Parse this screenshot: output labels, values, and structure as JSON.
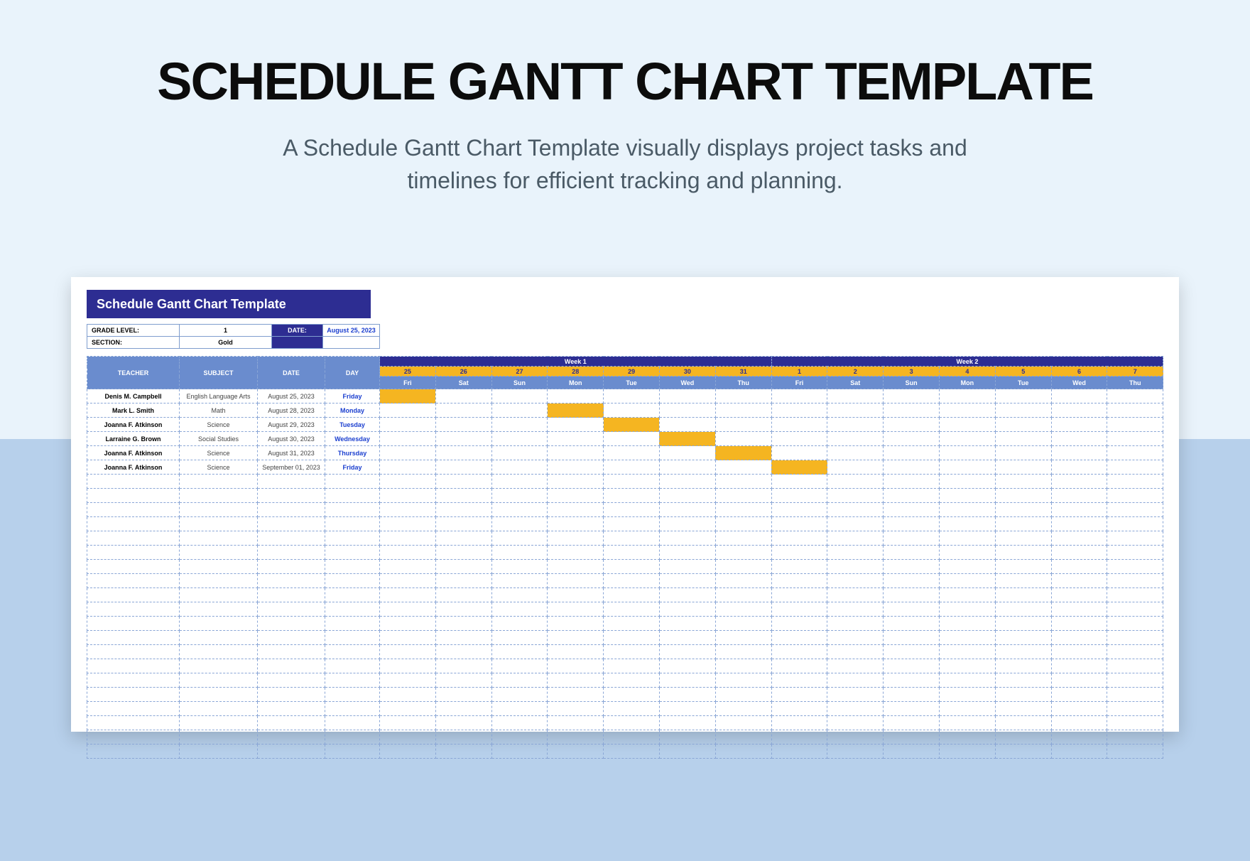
{
  "page": {
    "title": "SCHEDULE GANTT CHART TEMPLATE",
    "subtitle_l1": "A Schedule Gantt Chart Template visually displays project tasks and",
    "subtitle_l2": "timelines for efficient tracking and planning."
  },
  "sheet": {
    "title": "Schedule Gantt Chart Template",
    "meta": {
      "grade_label": "GRADE LEVEL:",
      "grade_value": "1",
      "date_label": "DATE:",
      "date_value": "August 25, 2023",
      "section_label": "SECTION:",
      "section_value": "Gold"
    },
    "headers": {
      "teacher": "TEACHER",
      "subject": "SUBJECT",
      "date": "DATE",
      "day": "DAY",
      "week1": "Week 1",
      "week2": "Week 2"
    },
    "days": [
      {
        "num": "25",
        "name": "Fri"
      },
      {
        "num": "26",
        "name": "Sat"
      },
      {
        "num": "27",
        "name": "Sun"
      },
      {
        "num": "28",
        "name": "Mon"
      },
      {
        "num": "29",
        "name": "Tue"
      },
      {
        "num": "30",
        "name": "Wed"
      },
      {
        "num": "31",
        "name": "Thu"
      },
      {
        "num": "1",
        "name": "Fri"
      },
      {
        "num": "2",
        "name": "Sat"
      },
      {
        "num": "3",
        "name": "Sun"
      },
      {
        "num": "4",
        "name": "Mon"
      },
      {
        "num": "5",
        "name": "Tue"
      },
      {
        "num": "6",
        "name": "Wed"
      },
      {
        "num": "7",
        "name": "Thu"
      }
    ],
    "rows": [
      {
        "teacher": "Denis M. Campbell",
        "subject": "English Language Arts",
        "date": "August 25, 2023",
        "day": "Friday",
        "bar": 0
      },
      {
        "teacher": "Mark L. Smith",
        "subject": "Math",
        "date": "August 28, 2023",
        "day": "Monday",
        "bar": 3
      },
      {
        "teacher": "Joanna F. Atkinson",
        "subject": "Science",
        "date": "August 29, 2023",
        "day": "Tuesday",
        "bar": 4
      },
      {
        "teacher": "Larraine G. Brown",
        "subject": "Social Studies",
        "date": "August 30, 2023",
        "day": "Wednesday",
        "bar": 5
      },
      {
        "teacher": "Joanna F. Atkinson",
        "subject": "Science",
        "date": "August 31, 2023",
        "day": "Thursday",
        "bar": 6
      },
      {
        "teacher": "Joanna F. Atkinson",
        "subject": "Science",
        "date": "September 01, 2023",
        "day": "Friday",
        "bar": 7
      }
    ],
    "empty_rows": 20
  },
  "chart_data": {
    "type": "bar",
    "title": "Schedule Gantt Chart Template",
    "xlabel": "Date",
    "ylabel": "Teacher / Subject",
    "categories": [
      "Aug 25 Fri",
      "Aug 26 Sat",
      "Aug 27 Sun",
      "Aug 28 Mon",
      "Aug 29 Tue",
      "Aug 30 Wed",
      "Aug 31 Thu",
      "Sep 1 Fri",
      "Sep 2 Sat",
      "Sep 3 Sun",
      "Sep 4 Mon",
      "Sep 5 Tue",
      "Sep 6 Wed",
      "Sep 7 Thu"
    ],
    "series": [
      {
        "name": "Denis M. Campbell — English Language Arts",
        "start": "2023-08-25",
        "end": "2023-08-25",
        "day_index": 0
      },
      {
        "name": "Mark L. Smith — Math",
        "start": "2023-08-28",
        "end": "2023-08-28",
        "day_index": 3
      },
      {
        "name": "Joanna F. Atkinson — Science",
        "start": "2023-08-29",
        "end": "2023-08-29",
        "day_index": 4
      },
      {
        "name": "Larraine G. Brown — Social Studies",
        "start": "2023-08-30",
        "end": "2023-08-30",
        "day_index": 5
      },
      {
        "name": "Joanna F. Atkinson — Science",
        "start": "2023-08-31",
        "end": "2023-08-31",
        "day_index": 6
      },
      {
        "name": "Joanna F. Atkinson — Science",
        "start": "2023-09-01",
        "end": "2023-09-01",
        "day_index": 7
      }
    ],
    "xlim": [
      "2023-08-25",
      "2023-09-07"
    ]
  }
}
